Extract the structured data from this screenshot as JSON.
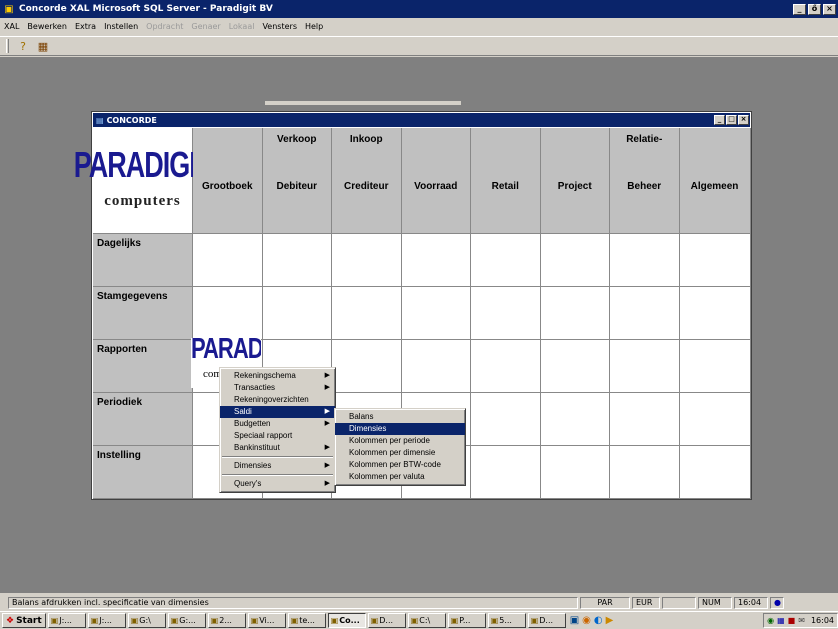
{
  "window": {
    "title": "Concorde XAL Microsoft SQL Server - Paradigit BV",
    "min": "_",
    "max": "ő",
    "close": "×"
  },
  "menubar": {
    "items": [
      {
        "label": "XAL",
        "enabled": true
      },
      {
        "label": "Bewerken",
        "enabled": true
      },
      {
        "label": "Extra",
        "enabled": true
      },
      {
        "label": "Instellen",
        "enabled": true
      },
      {
        "label": "Opdracht",
        "enabled": false
      },
      {
        "label": "Genaer",
        "enabled": false
      },
      {
        "label": "Lokaal",
        "enabled": false
      },
      {
        "label": "Vensters",
        "enabled": true
      },
      {
        "label": "Help",
        "enabled": true
      }
    ]
  },
  "toolbar": {
    "help_glyph": "?",
    "grid_glyph": "▦"
  },
  "child": {
    "title": "CONCORDE",
    "icon": "▤",
    "min": "_",
    "max": "□",
    "close": "×",
    "logo_text": "PARADIGIT",
    "logo_sub": "computers",
    "mini_logo_text": "PARADIGIT",
    "mini_logo_sub": "com",
    "columns": [
      {
        "top": "",
        "bottom": "Grootboek"
      },
      {
        "top": "Verkoop",
        "bottom": "Debiteur"
      },
      {
        "top": "Inkoop",
        "bottom": "Crediteur"
      },
      {
        "top": "",
        "bottom": "Voorraad"
      },
      {
        "top": "",
        "bottom": "Retail"
      },
      {
        "top": "",
        "bottom": "Project"
      },
      {
        "top": "Relatie-",
        "bottom": "Beheer"
      },
      {
        "top": "",
        "bottom": "Algemeen"
      }
    ],
    "rows": [
      "Dagelijks",
      "Stamgegevens",
      "Rapporten",
      "Periodiek",
      "Instelling"
    ]
  },
  "context_menu": {
    "items": [
      {
        "label": "Rekeningschema",
        "sub": true
      },
      {
        "label": "Transacties",
        "sub": true
      },
      {
        "label": "Rekeningoverzichten",
        "sub": false
      },
      {
        "label": "Saldi",
        "sub": true,
        "selected": true
      },
      {
        "label": "Budgetten",
        "sub": true
      },
      {
        "label": "Speciaal rapport",
        "sub": false
      },
      {
        "label": "Bankinstituut",
        "sub": true
      },
      {
        "sep": true
      },
      {
        "label": "Dimensies",
        "sub": true
      },
      {
        "sep": true
      },
      {
        "label": "Query's",
        "sub": true
      }
    ]
  },
  "submenu": {
    "items": [
      {
        "label": "Balans"
      },
      {
        "label": "Dimensies",
        "selected": true
      },
      {
        "label": "Kolommen per periode"
      },
      {
        "label": "Kolommen per dimensie"
      },
      {
        "label": "Kolommen per BTW-code"
      },
      {
        "label": "Kolommen per valuta"
      }
    ]
  },
  "statusbar": {
    "message": "Balans afdrukken incl. specificatie van dimensies",
    "par": "PAR",
    "eur": "EUR",
    "num": "NUM",
    "time": "16:04"
  },
  "taskbar": {
    "start": "Start",
    "buttons": [
      "J:...",
      "J:...",
      "G:\\",
      "G:...",
      "2...",
      "Vi...",
      "te...",
      "Co...",
      "D...",
      "C:\\",
      "P...",
      "5...",
      "D..."
    ],
    "active_index": 7,
    "clock": "16:04"
  }
}
